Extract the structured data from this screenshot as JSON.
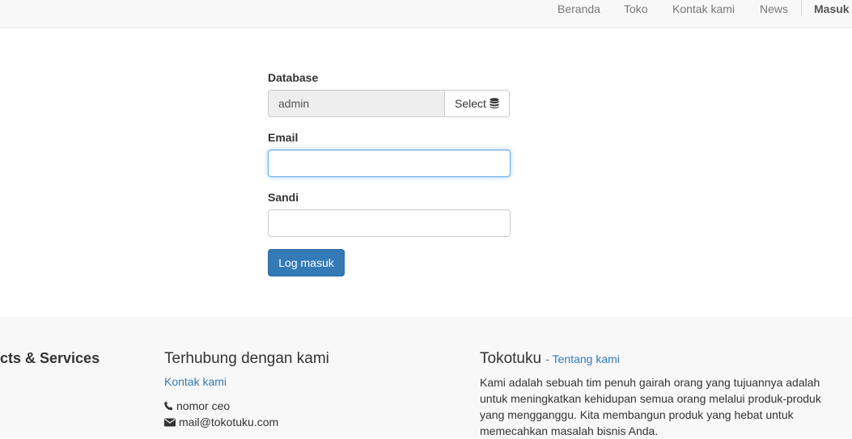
{
  "nav": {
    "items": [
      "Beranda",
      "Toko",
      "Kontak kami",
      "News"
    ],
    "active_label": "Masuk"
  },
  "form": {
    "database_label": "Database",
    "database_value": "admin",
    "select_label": "Select",
    "email_label": "Email",
    "email_value": "",
    "password_label": "Sandi",
    "password_value": "",
    "submit_label": "Log masuk"
  },
  "footer": {
    "products_heading": "cts & Services",
    "contact_heading": "Terhubung dengan kami",
    "contact_link": "Kontak kami",
    "phone_text": "nomor ceo",
    "email_text": "mail@tokotuku.com",
    "about_title": "Tokotuku",
    "about_link": "- Tentang kami",
    "about_text": "Kami adalah sebuah tim penuh gairah orang yang tujuannya adalah untuk meningkatkan kehidupan semua orang melalui produk-produk yang mengganggu. Kita membangun produk yang hebat untuk memecahkan masalah bisnis Anda."
  },
  "icons": {
    "select": "database-icon",
    "phone": "phone-icon",
    "mail": "envelope-icon"
  },
  "colors": {
    "primary": "#337ab7",
    "focus": "#66afe9",
    "navbar_bg": "#f8f8f8",
    "footer_bg": "#f8f8f8"
  }
}
